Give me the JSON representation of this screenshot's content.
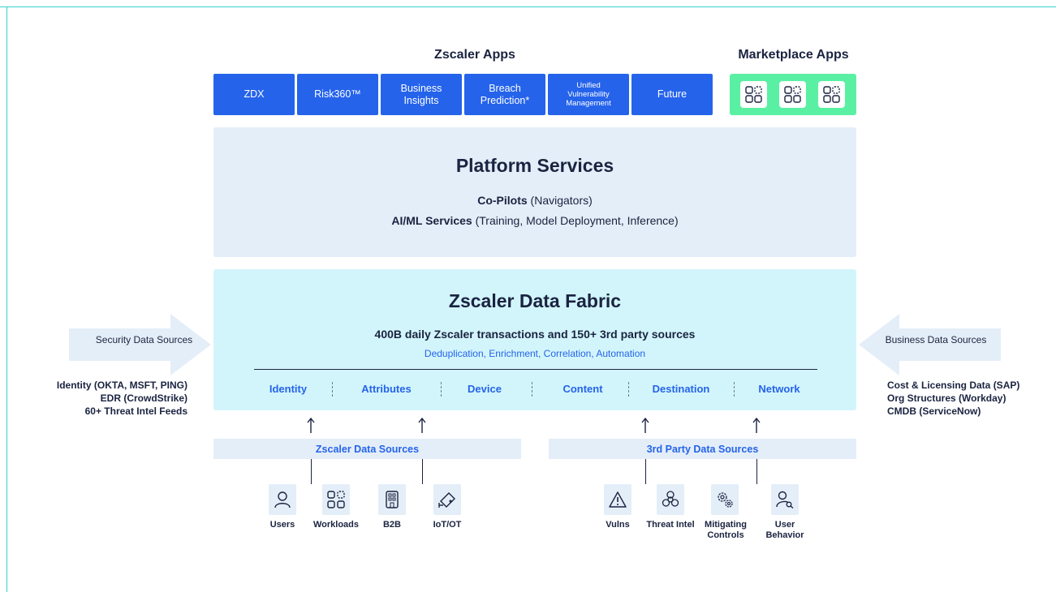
{
  "diagram": {
    "zscaler_apps": {
      "title": "Zscaler Apps",
      "tiles": [
        "ZDX",
        "Risk360™",
        "Business Insights",
        "Breach Prediction*",
        "Unified Vulnerability Management",
        "Future"
      ]
    },
    "marketplace_apps": {
      "title": "Marketplace Apps"
    },
    "platform_services": {
      "title": "Platform Services",
      "line1_bold": "Co-Pilots",
      "line1_rest": " (Navigators)",
      "line2_bold": "AI/ML Services",
      "line2_rest": " (Training, Model Deployment, Inference)"
    },
    "data_fabric": {
      "title": "Zscaler Data Fabric",
      "subtitle": "400B daily Zscaler transactions and 150+ 3rd party sources",
      "processing": "Deduplication, Enrichment, Correlation, Automation",
      "categories": [
        "Identity",
        "Attributes",
        "Device",
        "Content",
        "Destination",
        "Network"
      ]
    },
    "security_sources": {
      "label": "Security Data Sources",
      "items": [
        "Identity (OKTA, MSFT, PING)",
        "EDR (CrowdStrike)",
        "60+ Threat Intel Feeds"
      ]
    },
    "business_sources": {
      "label": "Business Data Sources",
      "items": [
        "Cost & Licensing Data (SAP)",
        "Org Structures (Workday)",
        "CMDB (ServiceNow)"
      ]
    },
    "zscaler_data_sources": {
      "label": "Zscaler Data Sources",
      "items": [
        "Users",
        "Workloads",
        "B2B",
        "IoT/OT"
      ]
    },
    "third_party_sources": {
      "label": "3rd Party Data Sources",
      "items": [
        "Vulns",
        "Threat Intel",
        "Mitigating Controls",
        "User Behavior"
      ]
    },
    "colors": {
      "primary_blue": "#2563eb",
      "marketplace_green": "#5af0a3",
      "platform_bg": "#e4eef8",
      "fabric_bg": "#d2f5fb",
      "text_dark": "#1a2340"
    }
  }
}
